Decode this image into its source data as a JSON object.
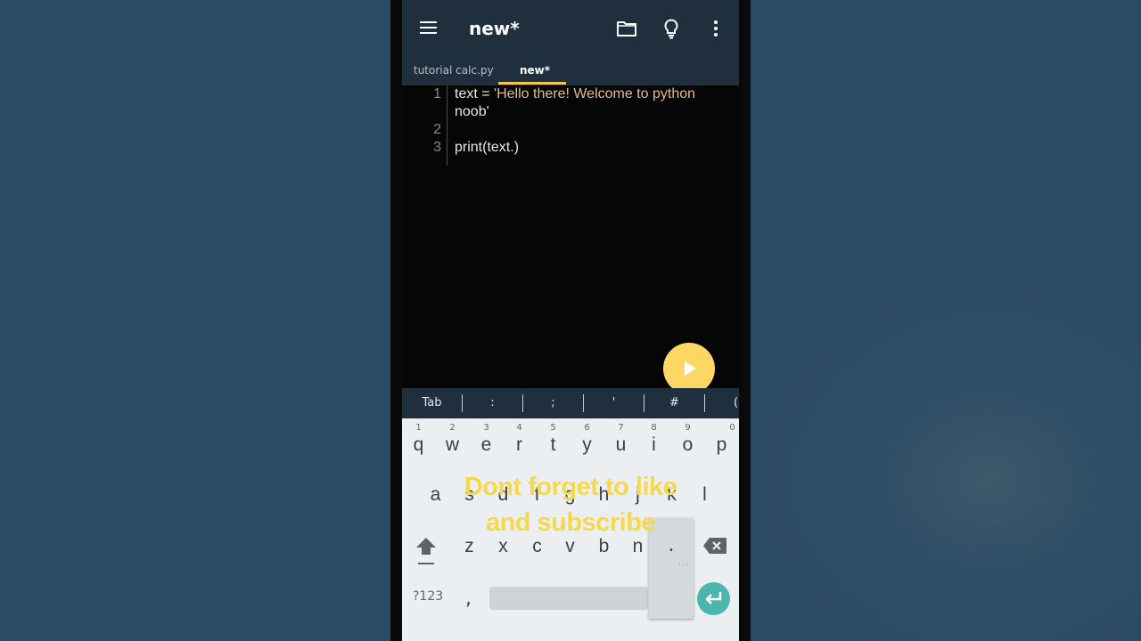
{
  "appbar": {
    "title": "new*",
    "icons": [
      "menu-icon",
      "folder-icon",
      "lightbulb-icon",
      "more-vert-icon"
    ]
  },
  "tabs": [
    {
      "label": "tutorial calc.py",
      "active": false
    },
    {
      "label": "new*",
      "active": true
    }
  ],
  "editor": {
    "line_numbers": [
      "1",
      "2",
      "3"
    ],
    "line1_prefix": "text = ",
    "line1_string": "'Hello there! Welcome to python",
    "line1_string_wrap": "noob'",
    "line3_code": "print(text.)"
  },
  "run_button": {
    "icon": "play-icon",
    "color": "#fdd663"
  },
  "symbol_bar": [
    "Tab",
    ":",
    ";",
    "'",
    "#",
    "("
  ],
  "keyboard": {
    "row1": [
      {
        "key": "q",
        "hint": "1"
      },
      {
        "key": "w",
        "hint": "2"
      },
      {
        "key": "e",
        "hint": "3"
      },
      {
        "key": "r",
        "hint": "4"
      },
      {
        "key": "t",
        "hint": "5"
      },
      {
        "key": "y",
        "hint": "6"
      },
      {
        "key": "u",
        "hint": "7"
      },
      {
        "key": "i",
        "hint": "8"
      },
      {
        "key": "o",
        "hint": "9"
      },
      {
        "key": "p",
        "hint": "0"
      }
    ],
    "row2": [
      "a",
      "s",
      "d",
      "f",
      "g",
      "h",
      "j",
      "k",
      "l"
    ],
    "row3": [
      "z",
      "x",
      "c",
      "v",
      "b",
      "n"
    ],
    "popup_key": ".",
    "popup_more": "...",
    "numbers_key": "?123",
    "comma_key": ",",
    "accent_color": "#4db6ac"
  },
  "overlay": {
    "line1": "Dont forget to like",
    "line2": "and subscribe",
    "color": "#f6d94a"
  }
}
